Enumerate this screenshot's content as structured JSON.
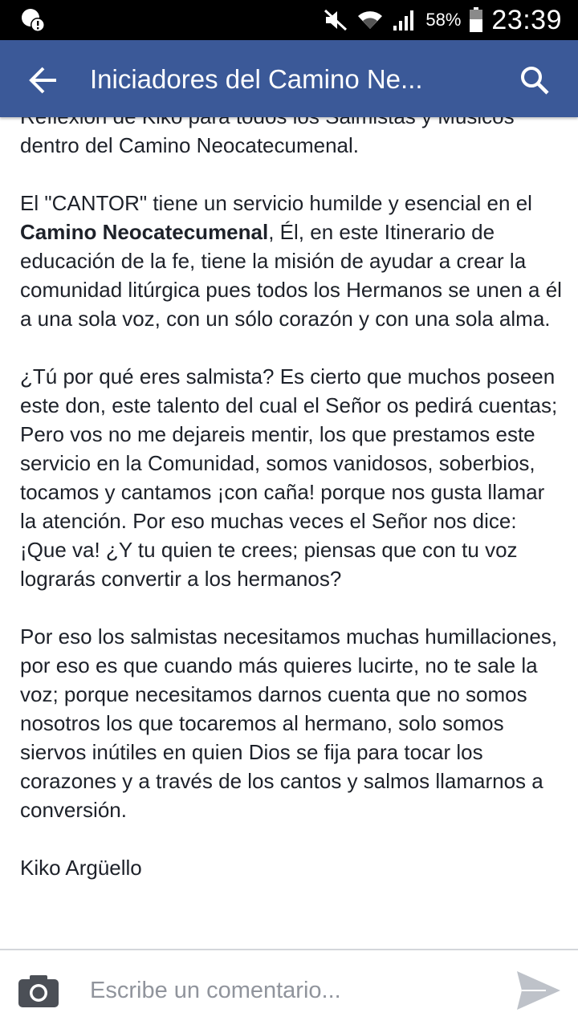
{
  "status_bar": {
    "battery_text": "58%",
    "time": "23:39",
    "icons": [
      "notification-icon",
      "mute-icon",
      "wifi-icon",
      "signal-icon",
      "battery-icon"
    ]
  },
  "app_bar": {
    "title": "Iniciadores del Camino Ne...",
    "back_icon": "back-arrow-icon",
    "search_icon": "search-icon",
    "color": "#3b5998"
  },
  "post": {
    "paragraph_1": "Reflexión de Kiko para todos los Salmistas y Músicos dentro del Camino Neocatecumenal.",
    "paragraph_2_start": "El \"CANTOR\" tiene un servicio humilde y esencial en el ",
    "paragraph_2_bold": "Camino Neocatecumenal",
    "paragraph_2_end": ", Él, en este Itinerario de educación de la fe, tiene la misión de ayudar a crear la comunidad litúrgica pues todos los Hermanos se unen a él a una sola voz, con un sólo corazón y con una sola alma.",
    "paragraph_3": "¿Tú por qué eres salmista? Es cierto que muchos poseen este don, este talento del cual el Señor os pedirá cuentas; Pero vos no me dejareis mentir, los que prestamos este servicio en la Comunidad, somos vanidosos, soberbios, tocamos y cantamos ¡con caña!  porque nos gusta llamar la atención. Por eso muchas veces el Señor nos dice: ¡Que va! ¿Y tu quien te crees; piensas que con tu voz lograrás convertir a los hermanos?",
    "paragraph_4": "Por eso los salmistas necesitamos muchas humillaciones, por eso es que cuando más quieres lucirte, no te sale la voz; porque necesitamos darnos cuenta que no somos nosotros los que tocaremos al hermano, solo somos siervos inútiles en quien Dios se fija para tocar los corazones y a través de los cantos y salmos llamarnos a conversión.",
    "signature": "Kiko Argüello"
  },
  "comment_bar": {
    "placeholder": "Escribe un comentario...",
    "camera_icon": "camera-icon",
    "send_icon": "send-icon"
  }
}
